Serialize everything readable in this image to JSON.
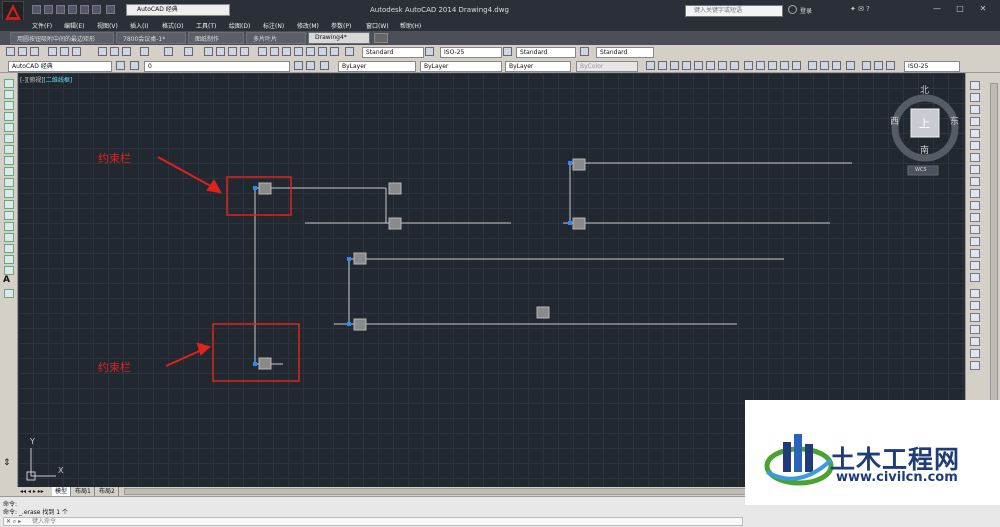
{
  "window": {
    "app_title": "Autodesk AutoCAD 2014    Drawing4.dwg",
    "workspace": "AutoCAD 经典",
    "search_placeholder": "键入关键字或短语",
    "login_label": "登录",
    "controls": [
      "—",
      "□",
      "✕"
    ]
  },
  "menu": [
    "文件(F)",
    "编辑(E)",
    "视图(V)",
    "插入(I)",
    "格式(O)",
    "工具(T)",
    "绘图(D)",
    "标注(N)",
    "修改(M)",
    "参数(P)",
    "窗口(W)",
    "帮助(H)"
  ],
  "doc_tabs": [
    {
      "label": "用圆按钮吸附中间的最边矩形",
      "active": false
    },
    {
      "label": "7800会议桌-1*",
      "active": false
    },
    {
      "label": "图纸制作",
      "active": false
    },
    {
      "label": "多片叶片",
      "active": false
    },
    {
      "label": "Drawing4*",
      "active": true
    }
  ],
  "toolbar1": {
    "text_style": "Standard",
    "dim_style": "ISO-25",
    "table_style": "Standard",
    "mleader_style": "Standard"
  },
  "toolbar2": {
    "workspace": "AutoCAD 经典",
    "layer": "0",
    "color": "ByLayer",
    "linetype": "ByLayer",
    "lineweight": "ByLayer",
    "plotstyle": "ByColor",
    "dim_style2": "ISO-25"
  },
  "viewport": {
    "label_prefix": "[-][俯视]",
    "label_style": "[二维线框]"
  },
  "viewcube": {
    "north": "北",
    "south": "南",
    "east": "东",
    "west": "西",
    "top": "上",
    "wcs": "WCS"
  },
  "annotations": [
    {
      "text": "约束栏"
    },
    {
      "text": "约束栏"
    }
  ],
  "ucs": {
    "x": "X",
    "y": "Y"
  },
  "layout_tabs": [
    "模型",
    "布局1",
    "布局2"
  ],
  "command": {
    "line1": "命令:",
    "line2": "命令: _.erase 找到 1 个",
    "placeholder": "键入命令"
  },
  "watermark": {
    "title": "土木工程网",
    "url": "www.civilcn.com"
  },
  "colors": {
    "canvas": "#212830",
    "annotation": "#e0221c",
    "geometry": "#c9c9c9",
    "grip": "#1e90ff"
  }
}
